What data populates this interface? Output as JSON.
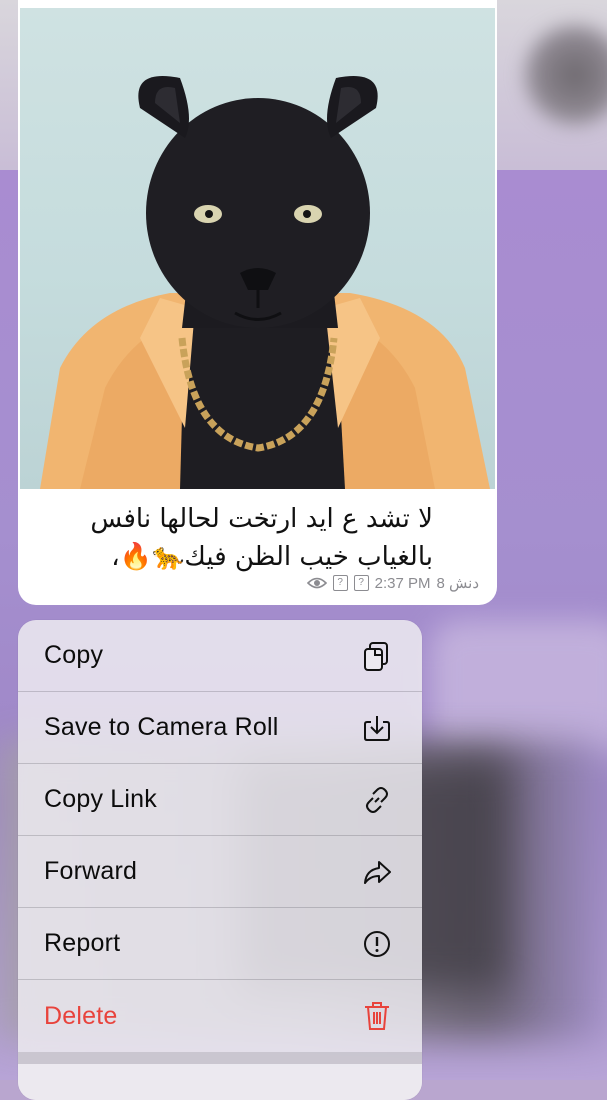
{
  "message": {
    "caption_line1": "لا تشد ع ايد ارتخت لحالها نافس",
    "caption_line2": "بالغياب خيب الظن فيك🐆🔥،",
    "views": "8 دنش",
    "time": "2:37 PM",
    "unknown_glyphs": "?"
  },
  "menu": {
    "items": [
      {
        "label": "Copy",
        "icon": "copy-icon"
      },
      {
        "label": "Save to Camera Roll",
        "icon": "save-icon"
      },
      {
        "label": "Copy Link",
        "icon": "link-icon"
      },
      {
        "label": "Forward",
        "icon": "forward-icon"
      },
      {
        "label": "Report",
        "icon": "report-icon"
      },
      {
        "label": "Delete",
        "icon": "trash-icon"
      }
    ]
  },
  "colors": {
    "danger": "#e8433c",
    "menu_bg": "#eceaf0",
    "chat_bg": "#a98cd1"
  }
}
